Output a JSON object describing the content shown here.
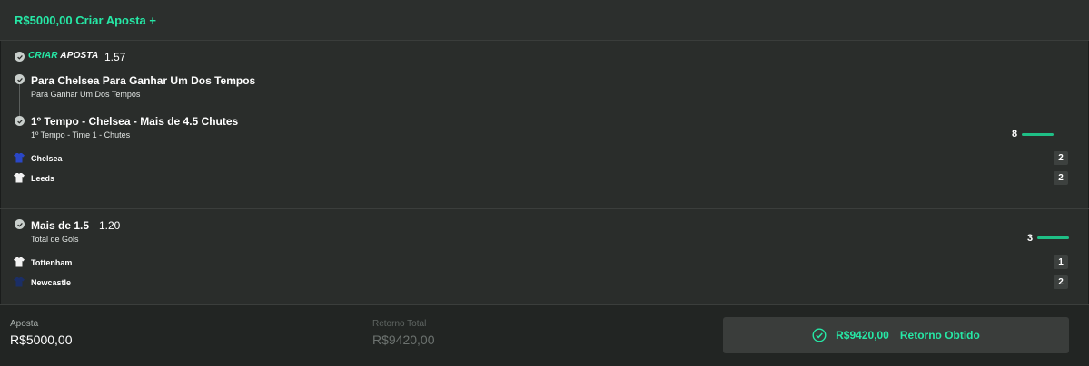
{
  "header": {
    "title": "R$5000,00 Criar Aposta +"
  },
  "builder": {
    "badge_part1": "CRIAR",
    "badge_part2": "APOSTA",
    "odds": "1.57",
    "selections": [
      {
        "title": "Para Chelsea Para Ganhar Um Dos Tempos",
        "subtitle": "Para Ganhar Um Dos Tempos"
      },
      {
        "title": "1º Tempo - Chelsea - Mais de 4.5 Chutes",
        "subtitle": "1º Tempo - Time 1 - Chutes"
      }
    ],
    "stat_value": "8",
    "stat_progress": 1.0,
    "teams": [
      {
        "name": "Chelsea",
        "score": "2",
        "jersey_color": "#2a47c7",
        "jersey_icon": "jersey-icon"
      },
      {
        "name": "Leeds",
        "score": "2",
        "jersey_color": "#f2f2f2",
        "jersey_icon": "jersey-icon"
      }
    ]
  },
  "single": {
    "title": "Mais de 1.5",
    "odds": "1.20",
    "subtitle": "Total de Gols",
    "stat_value": "3",
    "stat_progress": 1.0,
    "teams": [
      {
        "name": "Tottenham",
        "score": "1",
        "jersey_color": "#f2f2f2",
        "jersey_icon": "jersey-icon"
      },
      {
        "name": "Newcastle",
        "score": "2",
        "jersey_color": "#1b2e66",
        "jersey_icon": "jersey-icon"
      }
    ]
  },
  "footer": {
    "stake_label": "Aposta",
    "stake_value": "R$5000,00",
    "total_label": "Retorno Total",
    "total_value": "R$9420,00",
    "result_amount": "R$9420,00",
    "result_label": "Retorno Obtido"
  },
  "colors": {
    "accent": "#26e8a6",
    "bar": "#1fbf86",
    "background": "#2a2d2b"
  },
  "icons": {
    "check": "check-circle-icon",
    "result": "check-circle-outline-icon"
  }
}
